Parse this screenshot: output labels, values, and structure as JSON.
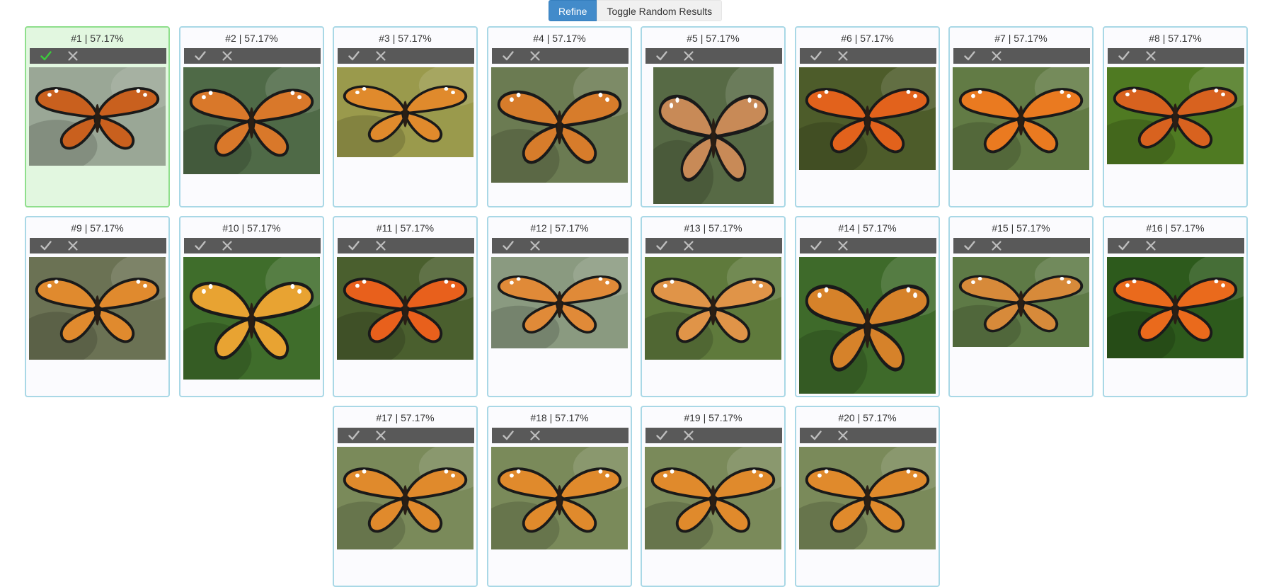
{
  "toolbar": {
    "refine_label": "Refine",
    "toggle_label": "Toggle Random Results"
  },
  "results": [
    {
      "label": "#1 | 57.17%",
      "selected": true,
      "bg": "#9aa796",
      "wing": "#c9601e",
      "img_w": 193,
      "img_h": 139
    },
    {
      "label": "#2 | 57.17%",
      "selected": false,
      "bg": "#4f6a47",
      "wing": "#d9782a",
      "img_w": 193,
      "img_h": 151
    },
    {
      "label": "#3 | 57.17%",
      "selected": false,
      "bg": "#9a9a4c",
      "wing": "#e08a2c",
      "img_w": 193,
      "img_h": 127
    },
    {
      "label": "#4 | 57.17%",
      "selected": false,
      "bg": "#6b7b52",
      "wing": "#d77c2b",
      "img_w": 193,
      "img_h": 163
    },
    {
      "label": "#5 | 57.17%",
      "selected": false,
      "bg": "#576a45",
      "wing": "#c88a57",
      "img_w": 170,
      "img_h": 193
    },
    {
      "label": "#6 | 57.17%",
      "selected": false,
      "bg": "#4d5c2a",
      "wing": "#e2621c",
      "img_w": 193,
      "img_h": 145
    },
    {
      "label": "#7 | 57.17%",
      "selected": false,
      "bg": "#627b45",
      "wing": "#ea7a20",
      "img_w": 193,
      "img_h": 145
    },
    {
      "label": "#8 | 57.17%",
      "selected": false,
      "bg": "#4f7a22",
      "wing": "#d8621f",
      "img_w": 193,
      "img_h": 137
    },
    {
      "label": "#9 | 57.17%",
      "selected": false,
      "bg": "#6b7254",
      "wing": "#e08a2e",
      "img_w": 193,
      "img_h": 145
    },
    {
      "label": "#10 | 57.17%",
      "selected": false,
      "bg": "#3f6d2b",
      "wing": "#e8a332",
      "img_w": 193,
      "img_h": 173
    },
    {
      "label": "#11 | 57.17%",
      "selected": false,
      "bg": "#4a5f2e",
      "wing": "#e8601c",
      "img_w": 193,
      "img_h": 145
    },
    {
      "label": "#12 | 57.17%",
      "selected": false,
      "bg": "#8a9a80",
      "wing": "#e08a38",
      "img_w": 193,
      "img_h": 129
    },
    {
      "label": "#13 | 57.17%",
      "selected": false,
      "bg": "#5f7a3c",
      "wing": "#e09448",
      "img_w": 193,
      "img_h": 145
    },
    {
      "label": "#14 | 57.17%",
      "selected": false,
      "bg": "#3e6a2a",
      "wing": "#d6822a",
      "img_w": 193,
      "img_h": 193
    },
    {
      "label": "#15 | 57.17%",
      "selected": false,
      "bg": "#5e7a46",
      "wing": "#d78a3a",
      "img_w": 193,
      "img_h": 127
    },
    {
      "label": "#16 | 57.17%",
      "selected": false,
      "bg": "#2d5a1c",
      "wing": "#ea6a1c",
      "img_w": 193,
      "img_h": 143
    },
    {
      "label": "#17 | 57.17%",
      "selected": false,
      "bg": "#7a8a5a",
      "wing": "#e08a2c",
      "img_w": 193,
      "img_h": 145
    },
    {
      "label": "#18 | 57.17%",
      "selected": false,
      "bg": "#7a8a5a",
      "wing": "#e08a2c",
      "img_w": 193,
      "img_h": 145
    },
    {
      "label": "#19 | 57.17%",
      "selected": false,
      "bg": "#7a8a5a",
      "wing": "#e08a2c",
      "img_w": 193,
      "img_h": 145
    },
    {
      "label": "#20 | 57.17%",
      "selected": false,
      "bg": "#7a8a5a",
      "wing": "#e08a2c",
      "img_w": 193,
      "img_h": 145
    }
  ],
  "icons": {
    "accept": "check-icon",
    "reject": "close-icon"
  },
  "colors": {
    "selected_check": "#3ccb3c",
    "inactive_icon": "#bdbdbd"
  }
}
